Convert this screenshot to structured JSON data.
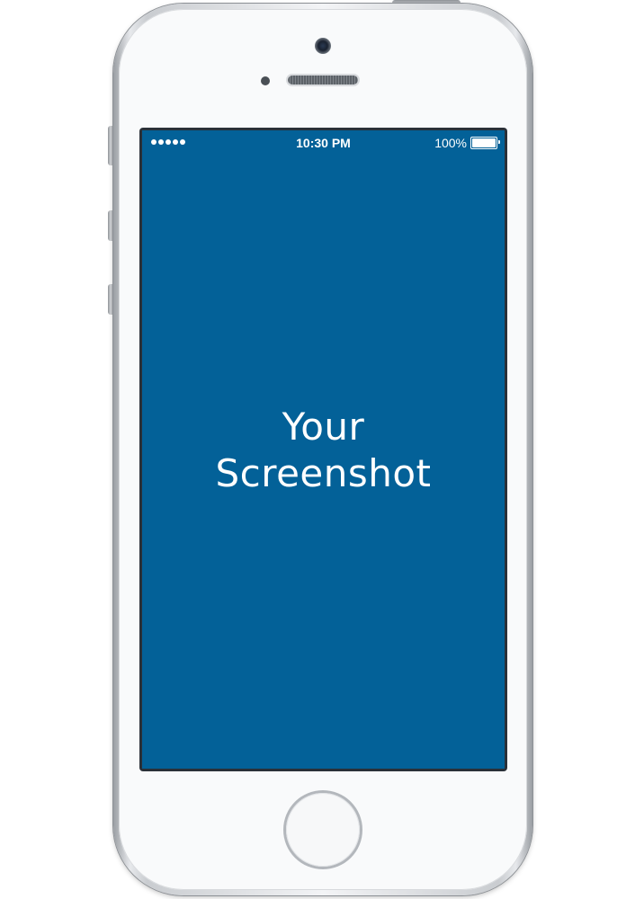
{
  "device": {
    "model": "iPhone",
    "color": "silver",
    "screen_bg_color": "#036198"
  },
  "status_bar": {
    "signal_dots": 5,
    "time": "10:30 PM",
    "battery_percent": "100%",
    "battery_level": 1.0
  },
  "screen": {
    "line1": "Your",
    "line2": "Screenshot"
  },
  "icons": {
    "camera": "front-camera-icon",
    "speaker": "earpiece-speaker-icon",
    "battery": "battery-icon",
    "signal": "signal-dots-icon",
    "home": "home-button"
  }
}
